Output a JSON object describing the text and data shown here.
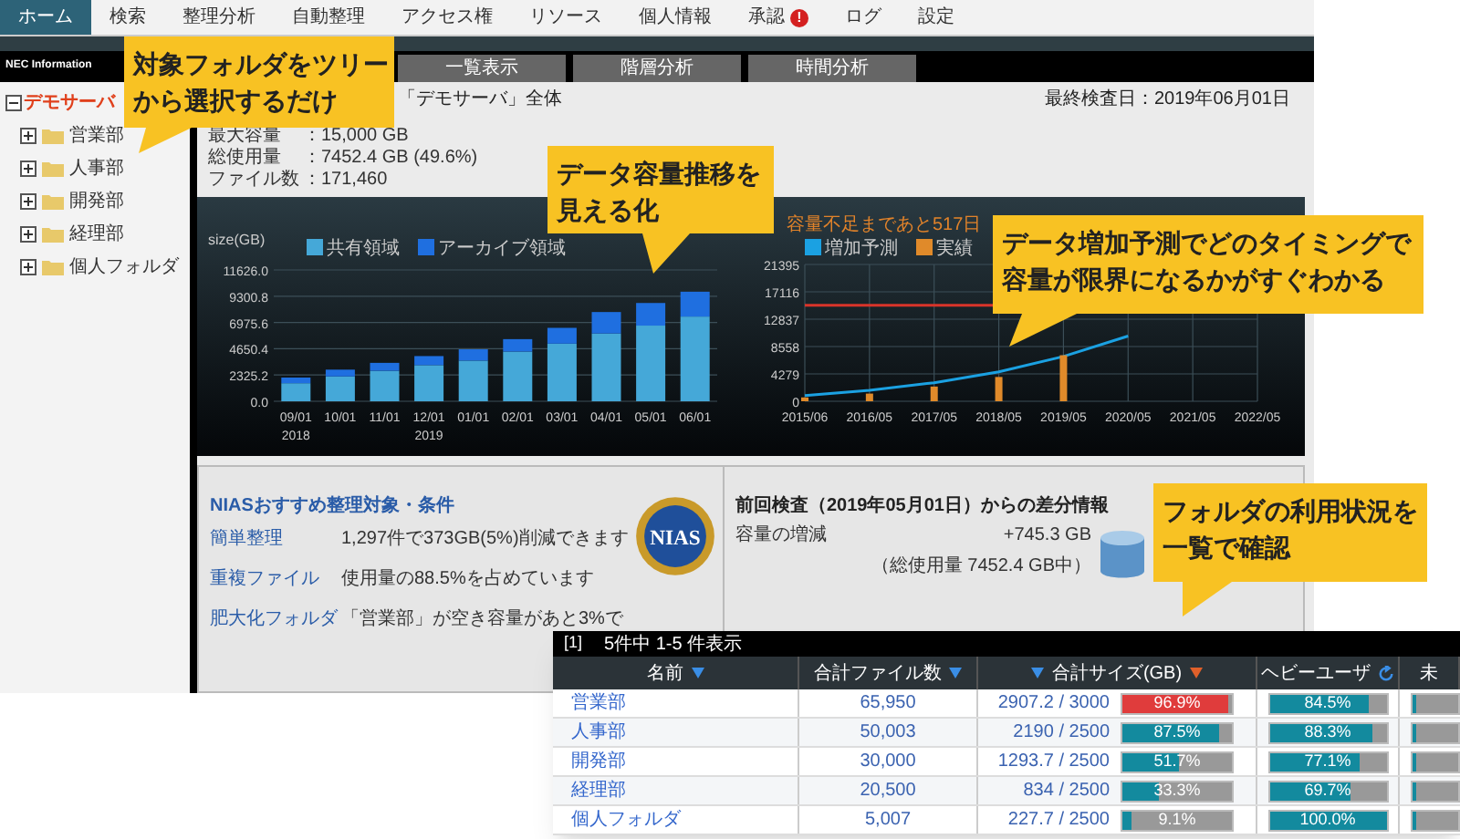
{
  "nav": {
    "items": [
      {
        "label": "ホーム",
        "selected": true
      },
      {
        "label": "検索",
        "selected": false
      },
      {
        "label": "整理分析",
        "selected": false
      },
      {
        "label": "自動整理",
        "selected": false
      },
      {
        "label": "アクセス権",
        "selected": false
      },
      {
        "label": "リソース",
        "selected": false
      },
      {
        "label": "個人情報",
        "selected": false
      },
      {
        "label": "承認",
        "selected": false,
        "badge": "!"
      },
      {
        "label": "ログ",
        "selected": false
      },
      {
        "label": "設定",
        "selected": false
      }
    ]
  },
  "brand": "NEC Information",
  "tabs": [
    {
      "label": "一覧表示",
      "selected": false
    },
    {
      "label": "階層分析",
      "selected": false
    },
    {
      "label": "時間分析",
      "selected": false
    }
  ],
  "tree": {
    "label": "デモサーバ",
    "expanded": true,
    "children": [
      {
        "label": "営業部",
        "expanded": false
      },
      {
        "label": "人事部",
        "expanded": false
      },
      {
        "label": "開発部",
        "expanded": false
      },
      {
        "label": "経理部",
        "expanded": false
      },
      {
        "label": "個人フォルダ",
        "expanded": false
      }
    ]
  },
  "overview": {
    "title": "「デモサーバ」全体",
    "last_inspected": "最終検査日：2019年06月01日",
    "stats": [
      {
        "label": "最大容量",
        "value": "：15,000 GB"
      },
      {
        "label": "総使用量",
        "value": "：7452.4 GB (49.6%)"
      },
      {
        "label": "ファイル数",
        "value": "：171,460"
      }
    ]
  },
  "growth_chart": {
    "unit_label": "size(GB)",
    "chart_data": {
      "type": "bar",
      "stacked": true,
      "grid": true,
      "legend": "top",
      "categories": [
        "09/01\n2018",
        "10/01",
        "11/01",
        "12/01\n2019",
        "01/01",
        "02/01",
        "03/01",
        "04/01",
        "05/01",
        "06/01"
      ],
      "ylim": [
        0,
        11626
      ],
      "yticks": [
        {
          "value": 0,
          "label": "0.0"
        },
        {
          "value": 2325.2,
          "label": "2325.2"
        },
        {
          "value": 4650.4,
          "label": "4650.4"
        },
        {
          "value": 6975.6,
          "label": "6975.6"
        },
        {
          "value": 9300.8,
          "label": "9300.8"
        },
        {
          "value": 11626,
          "label": "11626.0"
        }
      ],
      "series": [
        {
          "name": "共有領域",
          "color": "#45a8d8",
          "values": [
            1600,
            2200,
            2700,
            3200,
            3600,
            4400,
            5100,
            6000,
            6700,
            7500
          ]
        },
        {
          "name": "アーカイブ領域",
          "color": "#1f6fe0",
          "values": [
            500,
            600,
            700,
            800,
            1000,
            1100,
            1400,
            1900,
            2000,
            2200
          ]
        }
      ]
    }
  },
  "forecast_chart": {
    "title": "容量不足まであと517日",
    "chart_data": {
      "type": "line",
      "grid": true,
      "x": [
        "2015/06",
        "2016/05",
        "2017/05",
        "2018/05",
        "2019/05",
        "2020/05",
        "2021/05",
        "2022/05"
      ],
      "ylim": [
        0,
        21395
      ],
      "yticks": [
        0,
        4279,
        8558,
        12837,
        17116,
        21395
      ],
      "series": [
        {
          "name": "増加予測",
          "type": "line",
          "color": "#1ba1e2",
          "values": [
            900,
            1700,
            2900,
            4600,
            7000,
            10200,
            null,
            null
          ]
        },
        {
          "name": "実績",
          "type": "bar",
          "color": "#e08a2a",
          "values": [
            600,
            1200,
            2300,
            3800,
            7200,
            null,
            null,
            null
          ]
        }
      ],
      "legend": "top",
      "ref_lines": [
        {
          "axis": "y",
          "value": 15000,
          "color": "#d9342a"
        }
      ]
    }
  },
  "recommendations": {
    "title": "NIASおすすめ整理対象・条件",
    "logo": "NIAS",
    "items": [
      {
        "link": "簡単整理",
        "text": "1,297件で373GB(5%)削減できます"
      },
      {
        "link": "重複ファイル",
        "text": "使用量の88.5%を占めています"
      },
      {
        "link": "肥大化フォルダ",
        "text": "「営業部」が空き容量があと3%で"
      }
    ]
  },
  "diff": {
    "title": "前回検査（2019年05月01日）からの差分情報",
    "label": "容量の増減",
    "value": "+745.3 GB",
    "note": "（総使用量 7452.4 GB中）"
  },
  "table": {
    "page": "[1]",
    "summary": "5件中 1-5 件表示",
    "columns": [
      {
        "label": "名前",
        "kind": "sortable"
      },
      {
        "label": "合計ファイル数",
        "kind": "sortable"
      },
      {
        "label": "合計サイズ(GB)",
        "kind": "sorted"
      },
      {
        "label": "ヘビーユーザ",
        "kind": "refresh"
      },
      {
        "label": "未",
        "kind": "plain"
      }
    ],
    "rows": [
      {
        "name": "営業部",
        "files": "65,950",
        "size": "2907.2 / 3000",
        "usage": {
          "text": "96.9%",
          "level": 0.969,
          "alert": true
        },
        "heavy_user": {
          "text": "84.5%",
          "level": 0.845
        },
        "column_5": {
          "level": 0.06
        }
      },
      {
        "name": "人事部",
        "files": "50,003",
        "size": "2190 / 2500",
        "usage": {
          "text": "87.5%",
          "level": 0.875,
          "alert": false
        },
        "heavy_user": {
          "text": "88.3%",
          "level": 0.883
        },
        "column_5": {
          "level": 0.06
        }
      },
      {
        "name": "開発部",
        "files": "30,000",
        "size": "1293.7 / 2500",
        "usage": {
          "text": "51.7%",
          "level": 0.517,
          "alert": false
        },
        "heavy_user": {
          "text": "77.1%",
          "level": 0.771
        },
        "column_5": {
          "level": 0.06
        }
      },
      {
        "name": "経理部",
        "files": "20,500",
        "size": "834 / 2500",
        "usage": {
          "text": "33.3%",
          "level": 0.333,
          "alert": false
        },
        "heavy_user": {
          "text": "69.7%",
          "level": 0.697
        },
        "column_5": {
          "level": 0.06
        }
      },
      {
        "name": "個人フォルダ",
        "files": "5,007",
        "size": "227.7 / 2500",
        "usage": {
          "text": "9.1%",
          "level": 0.091,
          "alert": false
        },
        "heavy_user": {
          "text": "100.0%",
          "level": 1.0
        },
        "column_5": {
          "level": 0.06
        }
      }
    ]
  },
  "callouts": [
    {
      "lines": [
        "対象フォルダをツリー",
        "から選択するだけ"
      ]
    },
    {
      "lines": [
        "データ容量推移を",
        "見える化"
      ]
    },
    {
      "lines": [
        "データ増加予測でどのタイミングで",
        "容量が限界になるかがすぐわかる"
      ]
    },
    {
      "lines": [
        "フォルダの利用状況を",
        "一覧で確認"
      ]
    }
  ]
}
